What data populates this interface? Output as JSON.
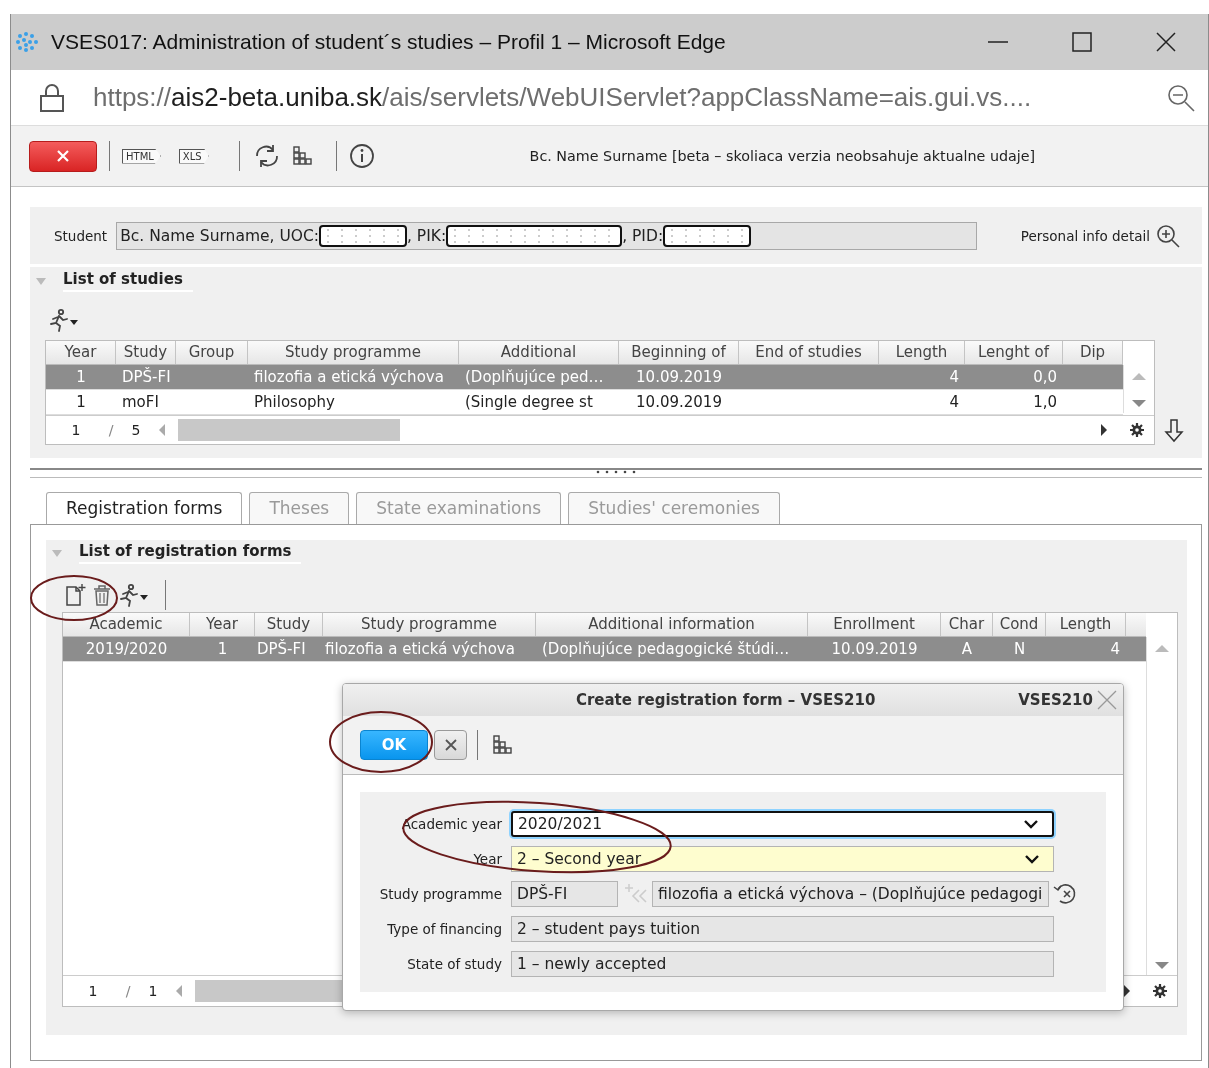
{
  "window": {
    "title": "VSES017: Administration of student´s studies – Profil 1 – Microsoft Edge"
  },
  "address_bar": {
    "url_parts": [
      {
        "kind": "scheme",
        "text": "https://"
      },
      {
        "kind": "host",
        "text": "ais2-beta.uniba.sk"
      },
      {
        "kind": "path",
        "text": "/ais/servlets/WebUIServlet?appClassName=ais.gui.vs...."
      }
    ]
  },
  "toolbar": {
    "buttons": [
      {
        "kind": "close"
      },
      {
        "kind": "separator"
      },
      {
        "kind": "export",
        "label": "HTML"
      },
      {
        "kind": "export",
        "label": "XLS"
      },
      {
        "kind": "separator"
      },
      {
        "kind": "refresh"
      },
      {
        "kind": "hierarchy"
      },
      {
        "kind": "separator"
      },
      {
        "kind": "info"
      }
    ],
    "status": "Bc. Name Surname [beta – skoliaca verzia neobsahuje aktualne udaje]"
  },
  "student": {
    "label": "Student",
    "parts": [
      {
        "kind": "text",
        "text": "Bc. Name Surname, UOC:"
      },
      {
        "kind": "redacted"
      },
      {
        "kind": "text",
        "text": ", PIK:"
      },
      {
        "kind": "redacted"
      },
      {
        "kind": "text",
        "text": ", PID:"
      },
      {
        "kind": "redacted"
      }
    ],
    "detail_link": "Personal info detail"
  },
  "studies": {
    "title": "List of studies",
    "expanded": true,
    "columns": [
      "Year",
      "Study",
      "Group",
      "Study programme",
      "Additional",
      "Beginning of",
      "End of studies",
      "Length",
      "Lenght of",
      "Dip"
    ],
    "rows": [
      {
        "selected": true,
        "cells": [
          "1",
          "DPŠ-FI",
          "",
          "filozofia a etická výchova",
          "(Doplňujúce ped…",
          "10.09.2019",
          "",
          "4",
          "0,0",
          ""
        ]
      },
      {
        "selected": false,
        "cells": [
          "1",
          "moFI",
          "",
          "Philosophy",
          "(Single degree st",
          "10.09.2019",
          "",
          "4",
          "1,0",
          ""
        ]
      }
    ],
    "pager": {
      "current": "1",
      "separator": "/",
      "total": "5"
    }
  },
  "tabs": [
    {
      "label": "Registration forms",
      "selected": true
    },
    {
      "label": "Theses",
      "selected": false
    },
    {
      "label": "State examinations",
      "selected": false
    },
    {
      "label": "Studies' ceremonies",
      "selected": false
    }
  ],
  "registration_forms": {
    "title": "List of registration forms",
    "expanded": true,
    "columns": [
      "Academic",
      "Year",
      "Study",
      "Study programme",
      "Additional information",
      "Enrollment",
      "Char",
      "Cond",
      "Length"
    ],
    "rows": [
      {
        "selected": true,
        "cells": [
          "2019/2020",
          "1",
          "DPŠ-FI",
          "filozofia a etická výchova",
          "(Doplňujúce pedagogické štúdi…",
          "10.09.2019",
          "A",
          "N",
          "4"
        ]
      }
    ],
    "pager": {
      "current": "1",
      "separator": "/",
      "total": "1"
    }
  },
  "dialog": {
    "title": "Create registration form – VSES210",
    "code": "VSES210",
    "ok": "OK",
    "fields": [
      {
        "label": "Academic year",
        "kind": "select",
        "value": "2020/2021",
        "focused": true,
        "required": false
      },
      {
        "label": "Year",
        "kind": "select",
        "value": "2 – Second year",
        "focused": false,
        "required": true
      },
      {
        "label": "Study programme",
        "kind": "lookup",
        "code": "DPŠ-FI",
        "value": "filozofia a etická výchova – (Doplňujúce pedagogi",
        "focused": false,
        "required": false
      },
      {
        "label": "Type of financing",
        "kind": "text",
        "value": "2 – student pays tuition",
        "focused": false,
        "required": false
      },
      {
        "label": "State of study",
        "kind": "text",
        "value": "1 – newly accepted",
        "focused": false,
        "required": false
      }
    ]
  }
}
